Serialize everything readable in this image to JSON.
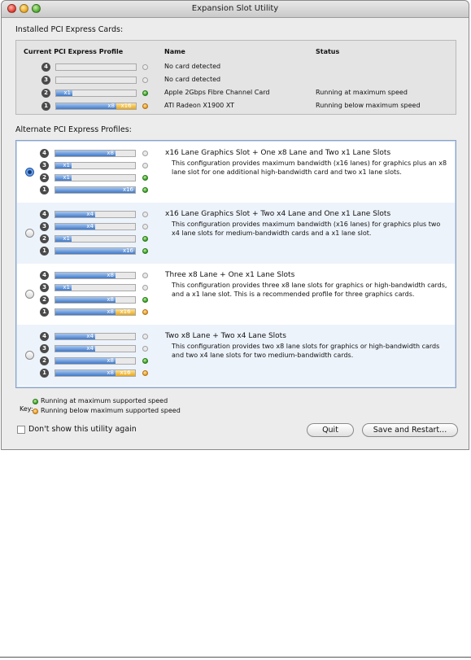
{
  "window": {
    "title": "Expansion Slot Utility"
  },
  "installed": {
    "section_label": "Installed PCI Express Cards:",
    "headers": {
      "profile": "Current PCI Express Profile",
      "name": "Name",
      "status": "Status"
    },
    "rows": [
      {
        "slot": "4",
        "bar": null,
        "indicator": "gray",
        "name": "No card detected",
        "status": ""
      },
      {
        "slot": "3",
        "bar": null,
        "indicator": "gray",
        "name": "No card detected",
        "status": ""
      },
      {
        "slot": "2",
        "bar": {
          "label": "x1",
          "fraction": 0.2,
          "extra": ""
        },
        "indicator": "green",
        "name": "Apple 2Gbps Fibre Channel Card",
        "status": "Running at maximum speed"
      },
      {
        "slot": "1",
        "bar": {
          "label": "x8",
          "fraction": 0.75,
          "extra": "x16"
        },
        "indicator": "orange",
        "name": "ATI Radeon X1900 XT",
        "status": "Running below maximum speed"
      }
    ]
  },
  "profiles": {
    "section_label": "Alternate PCI Express Profiles:",
    "items": [
      {
        "selected": true,
        "title": "x16 Lane Graphics Slot + One x8 Lane and Two x1 Lane Slots",
        "description": "This configuration provides maximum bandwidth (x16 lanes) for graphics plus an x8 lane slot for one additional high-bandwidth card and two x1 lane slots.",
        "slots": [
          {
            "slot": "4",
            "label": "x8",
            "fraction": 0.75,
            "extra": "",
            "indicator": "gray"
          },
          {
            "slot": "3",
            "label": "x1",
            "fraction": 0.2,
            "extra": "",
            "indicator": "gray"
          },
          {
            "slot": "2",
            "label": "x1",
            "fraction": 0.2,
            "extra": "",
            "indicator": "green"
          },
          {
            "slot": "1",
            "label": "x16",
            "fraction": 1.0,
            "extra": "",
            "indicator": "green"
          }
        ]
      },
      {
        "selected": false,
        "title": "x16 Lane Graphics Slot + Two x4 Lane and One x1 Lane Slots",
        "description": "This configuration provides maximum bandwidth (x16 lanes) for graphics plus two x4 lane slots for medium-bandwidth cards and a x1 lane slot.",
        "slots": [
          {
            "slot": "4",
            "label": "x4",
            "fraction": 0.5,
            "extra": "",
            "indicator": "gray"
          },
          {
            "slot": "3",
            "label": "x4",
            "fraction": 0.5,
            "extra": "",
            "indicator": "gray"
          },
          {
            "slot": "2",
            "label": "x1",
            "fraction": 0.2,
            "extra": "",
            "indicator": "green"
          },
          {
            "slot": "1",
            "label": "x16",
            "fraction": 1.0,
            "extra": "",
            "indicator": "green"
          }
        ]
      },
      {
        "selected": false,
        "title": "Three x8 Lane + One x1 Lane Slots",
        "description": "This configuration provides three x8 lane slots for graphics or high-bandwidth cards, and a x1 lane slot.  This is a recommended profile for three graphics cards.",
        "slots": [
          {
            "slot": "4",
            "label": "x8",
            "fraction": 0.75,
            "extra": "",
            "indicator": "gray"
          },
          {
            "slot": "3",
            "label": "x1",
            "fraction": 0.2,
            "extra": "",
            "indicator": "gray"
          },
          {
            "slot": "2",
            "label": "x8",
            "fraction": 0.75,
            "extra": "",
            "indicator": "green"
          },
          {
            "slot": "1",
            "label": "x8",
            "fraction": 0.75,
            "extra": "x16",
            "indicator": "orange"
          }
        ]
      },
      {
        "selected": false,
        "title": "Two x8 Lane + Two x4 Lane Slots",
        "description": "This configuration provides two x8 lane slots for graphics or high-bandwidth cards and two x4 lane slots for two medium-bandwidth cards.",
        "slots": [
          {
            "slot": "4",
            "label": "x4",
            "fraction": 0.5,
            "extra": "",
            "indicator": "gray"
          },
          {
            "slot": "3",
            "label": "x4",
            "fraction": 0.5,
            "extra": "",
            "indicator": "gray"
          },
          {
            "slot": "2",
            "label": "x8",
            "fraction": 0.75,
            "extra": "",
            "indicator": "green"
          },
          {
            "slot": "1",
            "label": "x8",
            "fraction": 0.75,
            "extra": "x16",
            "indicator": "orange"
          }
        ]
      }
    ]
  },
  "key": {
    "label": "Key:",
    "green": "Running at maximum supported speed",
    "orange": "Running below maximum supported speed"
  },
  "footer": {
    "dont_show_label": "Don't show this utility again",
    "dont_show_checked": false,
    "quit_label": "Quit",
    "save_label": "Save and Restart..."
  },
  "colors": {
    "lane_fill": "#3f78c8",
    "degraded_fill": "#e8a71a",
    "ok": "#2e9a1c",
    "warn": "#e7991e"
  }
}
